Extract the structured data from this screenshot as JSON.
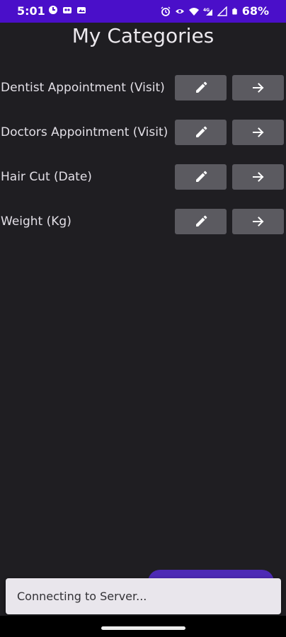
{
  "status_bar": {
    "time": "5:01",
    "battery": "68%",
    "left_icons": [
      "data-saver-icon",
      "photos-icon",
      "photos-icon"
    ],
    "right_icons": [
      "alarm-icon",
      "eye-icon",
      "wifi-icon",
      "signal-4g-icon",
      "signal-icon",
      "battery-icon"
    ],
    "network_label": "4G",
    "color": "#4a0fc9"
  },
  "header": {
    "title": "My Categories"
  },
  "categories": [
    {
      "label": "Dentist Appointment (Visit)",
      "edit_icon": "pencil-icon",
      "open_icon": "arrow-right-icon"
    },
    {
      "label": "Doctors Appointment (Visit)",
      "edit_icon": "pencil-icon",
      "open_icon": "arrow-right-icon"
    },
    {
      "label": "Hair Cut (Date)",
      "edit_icon": "pencil-icon",
      "open_icon": "arrow-right-icon"
    },
    {
      "label": "Weight (Kg)",
      "edit_icon": "pencil-icon",
      "open_icon": "arrow-right-icon"
    }
  ],
  "fab": {
    "color": "#4d2bb5"
  },
  "snackbar": {
    "message": "Connecting to Server..."
  },
  "theme": {
    "background": "#1f1e22",
    "button_bg": "#5b5a60"
  }
}
